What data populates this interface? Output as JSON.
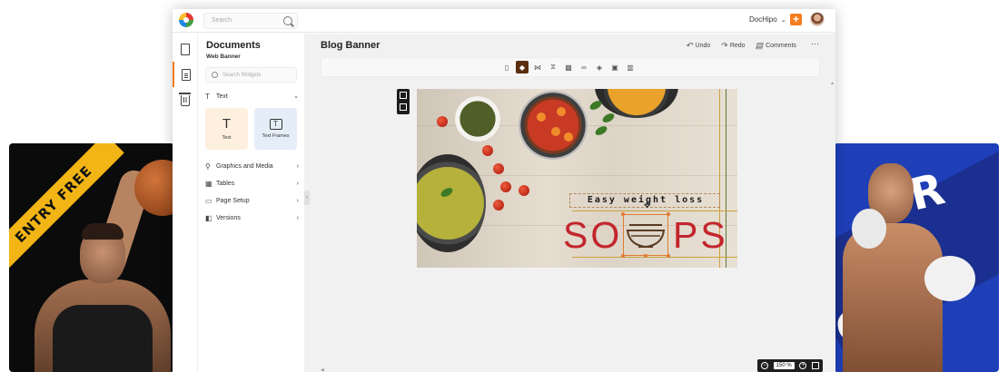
{
  "left_poster": {
    "ribbon_text": "ENTRY FREE"
  },
  "right_poster": {
    "letters_top": "ER",
    "letters_bottom": "CH"
  },
  "topbar": {
    "search_placeholder": "Search",
    "brand_menu": "DocHipo",
    "brand_chevron": "⌄",
    "add_label": "+"
  },
  "panel": {
    "title": "Documents",
    "subtitle": "Web Banner",
    "search_placeholder": "Search Widgets",
    "sections": [
      {
        "label": "Text",
        "icon": "T",
        "arrow": "⌄"
      },
      {
        "label": "Graphics and Media",
        "icon": "⚲",
        "arrow": "›"
      },
      {
        "label": "Tables",
        "icon": "▦",
        "arrow": "›"
      },
      {
        "label": "Page Setup",
        "icon": "▭",
        "arrow": "›"
      },
      {
        "label": "Versions",
        "icon": "◧",
        "arrow": "›"
      }
    ],
    "tiles": [
      {
        "label": "Text",
        "glyph": "T"
      },
      {
        "label": "Text Frames",
        "glyph": "T"
      }
    ]
  },
  "editor": {
    "document_title": "Blog Banner",
    "undo": "Undo",
    "redo": "Redo",
    "comments": "Comments",
    "more": "⋯"
  },
  "canvas": {
    "headline": "Easy weight loss",
    "title_part1": "SO",
    "title_part2": "PS"
  },
  "zoom": {
    "value": "150 %"
  },
  "colors": {
    "accent": "#f47c20",
    "selected_tool": "#5a2e0e",
    "title_red": "#c3252d"
  }
}
